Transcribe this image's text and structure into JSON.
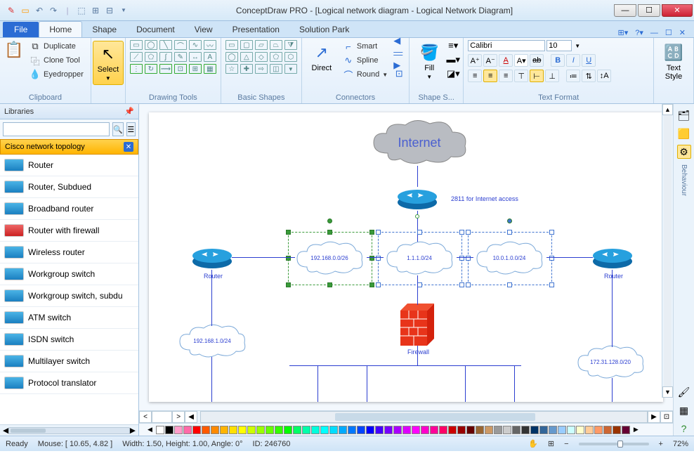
{
  "app": {
    "title": "ConceptDraw PRO - [Logical network diagram - Logical Network Diagram]"
  },
  "tabs": {
    "file": "File",
    "items": [
      "Home",
      "Shape",
      "Document",
      "View",
      "Presentation",
      "Solution Park"
    ],
    "active": 0
  },
  "ribbon": {
    "clipboard": {
      "label": "Clipboard",
      "duplicate": "Duplicate",
      "clone": "Clone Tool",
      "eyedropper": "Eyedropper"
    },
    "select": {
      "label": "Select"
    },
    "drawing": {
      "label": "Drawing Tools"
    },
    "shapes": {
      "label": "Basic Shapes"
    },
    "connectors": {
      "label": "Connectors",
      "direct": "Direct",
      "smart": "Smart",
      "spline": "Spline",
      "round": "Round"
    },
    "fill": {
      "label": "Fill"
    },
    "shapestyle": {
      "label": "Shape S..."
    },
    "textformat": {
      "label": "Text Format",
      "font": "Calibri",
      "size": "10"
    },
    "textstyle": {
      "label": "Text Style"
    }
  },
  "libraries": {
    "title": "Libraries",
    "category": "Cisco network topology",
    "items": [
      "Router",
      "Router, Subdued",
      "Broadband router",
      "Router with firewall",
      "Wireless router",
      "Workgroup switch",
      "Workgroup switch, subdu",
      "ATM switch",
      "ISDN switch",
      "Multilayer switch",
      "Protocol translator"
    ]
  },
  "diagram": {
    "internet": "Internet",
    "access_label": "2811 for Internet access",
    "subnet1": "192.168.0.0/26",
    "subnet2": "1.1.1.0/24",
    "subnet3": "10.0.1.0.0/24",
    "subnet4": "192.168.1.0/24",
    "subnet5": "172.31.128.0/20",
    "router_label": "Router",
    "firewall_label": "Firewall"
  },
  "rail": {
    "behaviour": "Behaviour"
  },
  "status": {
    "ready": "Ready",
    "mouse": "Mouse: [ 10.65, 4.82 ]",
    "dims": "Width: 1.50,  Height: 1.00,  Angle: 0°",
    "id": "ID: 246760",
    "zoom": "72%"
  },
  "palette": [
    "#ffffff",
    "#000000",
    "#ff9ecb",
    "#ff6aa8",
    "#ff0000",
    "#ff5a00",
    "#ff8a00",
    "#ffb400",
    "#ffe000",
    "#ffff00",
    "#ccff00",
    "#99ff00",
    "#66ff00",
    "#33ff00",
    "#00ff00",
    "#00ff66",
    "#00ffaa",
    "#00ffdd",
    "#00ffff",
    "#00ddff",
    "#00aaff",
    "#0077ff",
    "#0044ff",
    "#0000ff",
    "#4400ff",
    "#7700ff",
    "#aa00ff",
    "#dd00ff",
    "#ff00ff",
    "#ff00cc",
    "#ff0099",
    "#ff0066",
    "#cc0000",
    "#990000",
    "#660000",
    "#996633",
    "#cc9966",
    "#999999",
    "#cccccc",
    "#666666",
    "#333333",
    "#003366",
    "#336699",
    "#6699cc",
    "#99ccff",
    "#ccffff",
    "#ffffcc",
    "#ffcc99",
    "#ff9966",
    "#cc6633",
    "#993300",
    "#660033"
  ]
}
